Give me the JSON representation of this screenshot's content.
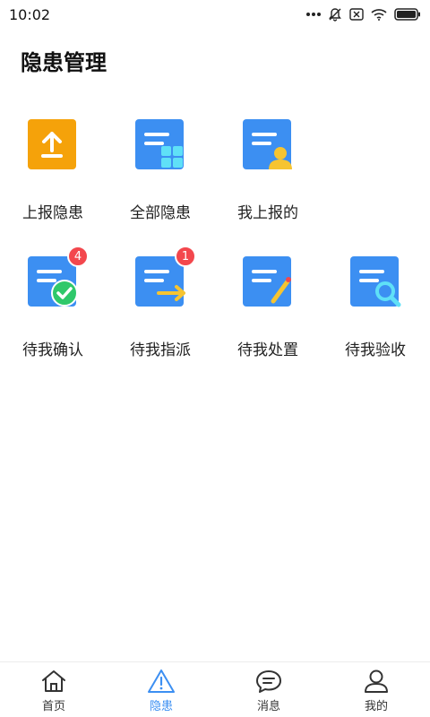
{
  "status_bar": {
    "time": "10:02"
  },
  "page": {
    "title": "隐患管理"
  },
  "grid": [
    {
      "label": "上报隐患",
      "icon": "upload-icon"
    },
    {
      "label": "全部隐患",
      "icon": "all-list-icon"
    },
    {
      "label": "我上报的",
      "icon": "my-report-icon"
    },
    {
      "label": "待我确认",
      "icon": "confirm-icon",
      "badge": "4"
    },
    {
      "label": "待我指派",
      "icon": "assign-icon",
      "badge": "1"
    },
    {
      "label": "待我处置",
      "icon": "handle-icon"
    },
    {
      "label": "待我验收",
      "icon": "accept-icon"
    }
  ],
  "tabbar": {
    "items": [
      {
        "label": "首页",
        "icon": "home-icon"
      },
      {
        "label": "隐患",
        "icon": "warning-icon",
        "active": true
      },
      {
        "label": "消息",
        "icon": "message-icon"
      },
      {
        "label": "我的",
        "icon": "user-icon"
      }
    ]
  },
  "colors": {
    "accent": "#3c8ff2",
    "orange": "#f5a20a",
    "badge": "#f3474d",
    "green": "#2fc86a",
    "yellow": "#f6c431",
    "cyan": "#5fe0f7"
  }
}
